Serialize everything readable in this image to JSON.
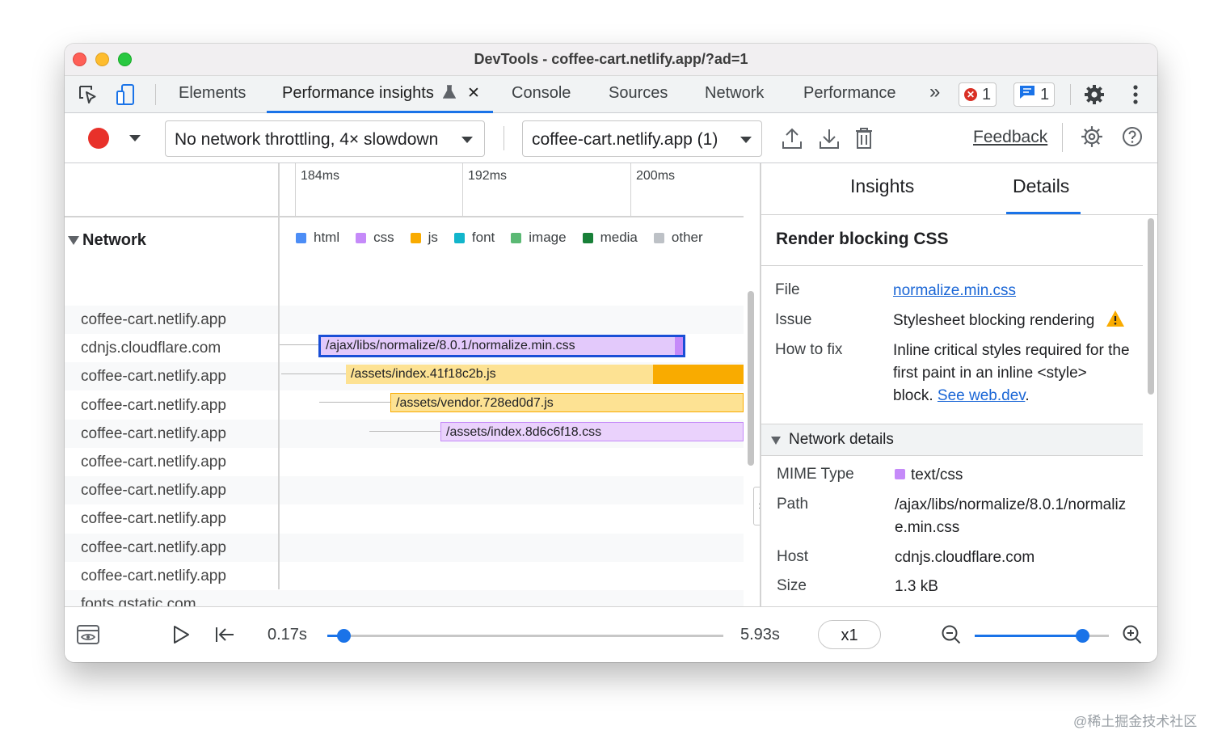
{
  "window": {
    "title": "DevTools - coffee-cart.netlify.app/?ad=1"
  },
  "tabs": [
    {
      "label": "Elements"
    },
    {
      "label": "Performance insights"
    },
    {
      "label": "Console"
    },
    {
      "label": "Sources"
    },
    {
      "label": "Network"
    },
    {
      "label": "Performance"
    }
  ],
  "badges": {
    "errors": "1",
    "messages": "1"
  },
  "toolbar": {
    "throttling": "No network throttling, 4× slowdown",
    "page": "coffee-cart.netlify.app (1)",
    "feedback": "Feedback"
  },
  "timeline": {
    "ticks": [
      "184ms",
      "192ms",
      "200ms"
    ],
    "section": "Network",
    "legend": [
      {
        "label": "html",
        "color": "#4c8df6"
      },
      {
        "label": "css",
        "color": "#c58af9"
      },
      {
        "label": "js",
        "color": "#f9ab00"
      },
      {
        "label": "font",
        "color": "#12b5cb"
      },
      {
        "label": "image",
        "color": "#5bb974"
      },
      {
        "label": "media",
        "color": "#188038"
      },
      {
        "label": "other",
        "color": "#bdc1c6"
      }
    ],
    "hosts": [
      "coffee-cart.netlify.app",
      "cdnjs.cloudflare.com",
      "coffee-cart.netlify.app",
      "coffee-cart.netlify.app",
      "coffee-cart.netlify.app",
      "coffee-cart.netlify.app",
      "coffee-cart.netlify.app",
      "coffee-cart.netlify.app",
      "coffee-cart.netlify.app",
      "coffee-cart.netlify.app",
      "fonts.gstatic.com"
    ],
    "requests": [
      {
        "label": "/ajax/libs/normalize/8.0.1/normalize.min.css",
        "type": "css",
        "selected": true
      },
      {
        "label": "/assets/index.41f18c2b.js",
        "type": "js"
      },
      {
        "label": "/assets/vendor.728ed0d7.js",
        "type": "js"
      },
      {
        "label": "/assets/index.8d6c6f18.css",
        "type": "css"
      }
    ]
  },
  "details": {
    "tabs": {
      "insights": "Insights",
      "details": "Details"
    },
    "title": "Render blocking CSS",
    "file_label": "File",
    "file_value": "normalize.min.css",
    "issue_label": "Issue",
    "issue_value": "Stylesheet blocking rendering",
    "fix_label": "How to fix",
    "fix_line1": "Inline critical styles required for the",
    "fix_line2": "first paint in an inline <style>",
    "fix_line3_prefix": "block. ",
    "fix_link": "See web.dev",
    "fix_suffix": ".",
    "network_details": "Network details",
    "mime_label": "MIME Type",
    "mime_value": "text/css",
    "path_label": "Path",
    "path_line1": "/ajax/libs/normalize/8.0.1/normaliz",
    "path_line2": "e.min.css",
    "host_label": "Host",
    "host_value": "cdnjs.cloudflare.com",
    "size_label": "Size",
    "size_value": "1.3 kB"
  },
  "playback": {
    "start": "0.17s",
    "end": "5.93s",
    "speed": "x1",
    "position": 0.04,
    "zoom": 0.8
  },
  "watermark": "@稀土掘金技术社区"
}
